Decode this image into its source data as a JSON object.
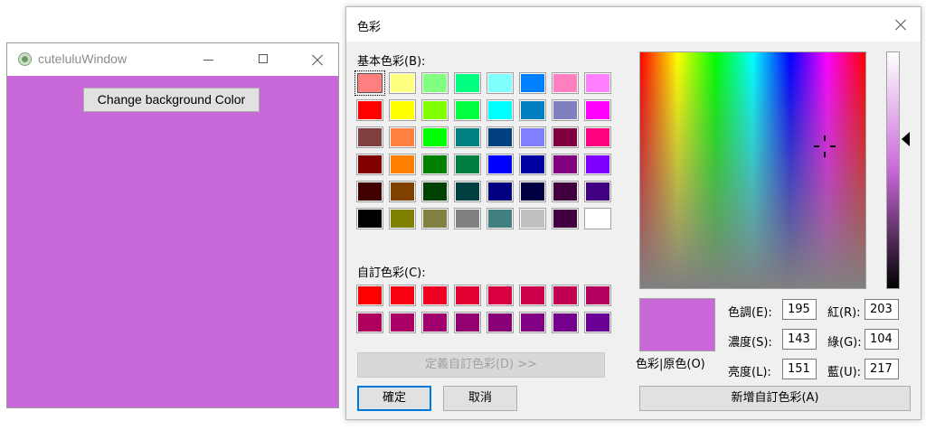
{
  "app_window": {
    "title": "cuteluluWindow",
    "background_color": "#c968d9",
    "button_label": "Change background Color"
  },
  "dialog": {
    "title": "色彩",
    "basic_label": "基本色彩(B):",
    "custom_label": "自訂色彩(C):",
    "basic_colors": [
      [
        "#ff8080",
        "#ffff80",
        "#80ff80",
        "#00ff80",
        "#80ffff",
        "#0080ff",
        "#ff80c0",
        "#ff80ff"
      ],
      [
        "#ff0000",
        "#ffff00",
        "#80ff00",
        "#00ff40",
        "#00ffff",
        "#0080c0",
        "#8080c0",
        "#ff00ff"
      ],
      [
        "#804040",
        "#ff8040",
        "#00ff00",
        "#008080",
        "#004080",
        "#8080ff",
        "#800040",
        "#ff0080"
      ],
      [
        "#800000",
        "#ff8000",
        "#008000",
        "#008040",
        "#0000ff",
        "#0000a0",
        "#800080",
        "#8000ff"
      ],
      [
        "#400000",
        "#804000",
        "#004000",
        "#004040",
        "#000080",
        "#000040",
        "#400040",
        "#400080"
      ],
      [
        "#000000",
        "#808000",
        "#808040",
        "#808080",
        "#408080",
        "#c0c0c0",
        "#400040",
        "#ffffff"
      ]
    ],
    "custom_colors": [
      [
        "#ff0000",
        "#f70012",
        "#ee0022",
        "#e30030",
        "#d8003e",
        "#cc004a",
        "#c20052",
        "#b60060"
      ],
      [
        "#b0005e",
        "#aa0066",
        "#a0006e",
        "#920072",
        "#880078",
        "#820084",
        "#76008e",
        "#6a0096"
      ]
    ],
    "define_custom_button": "定義自訂色彩(D) >>",
    "ok_button": "確定",
    "cancel_button": "取消",
    "preview_label": "色彩|原色(O)",
    "preview_color": "#cb68d9",
    "fields": {
      "hue": {
        "label": "色調(E):",
        "value": "195"
      },
      "sat": {
        "label": "濃度(S):",
        "value": "143"
      },
      "lum": {
        "label": "亮度(L):",
        "value": "151"
      },
      "red": {
        "label": "紅(R):",
        "value": "203"
      },
      "green": {
        "label": "綠(G):",
        "value": "104"
      },
      "blue": {
        "label": "藍(U):",
        "value": "217"
      }
    },
    "add_custom_button": "新增自訂色彩(A)"
  }
}
